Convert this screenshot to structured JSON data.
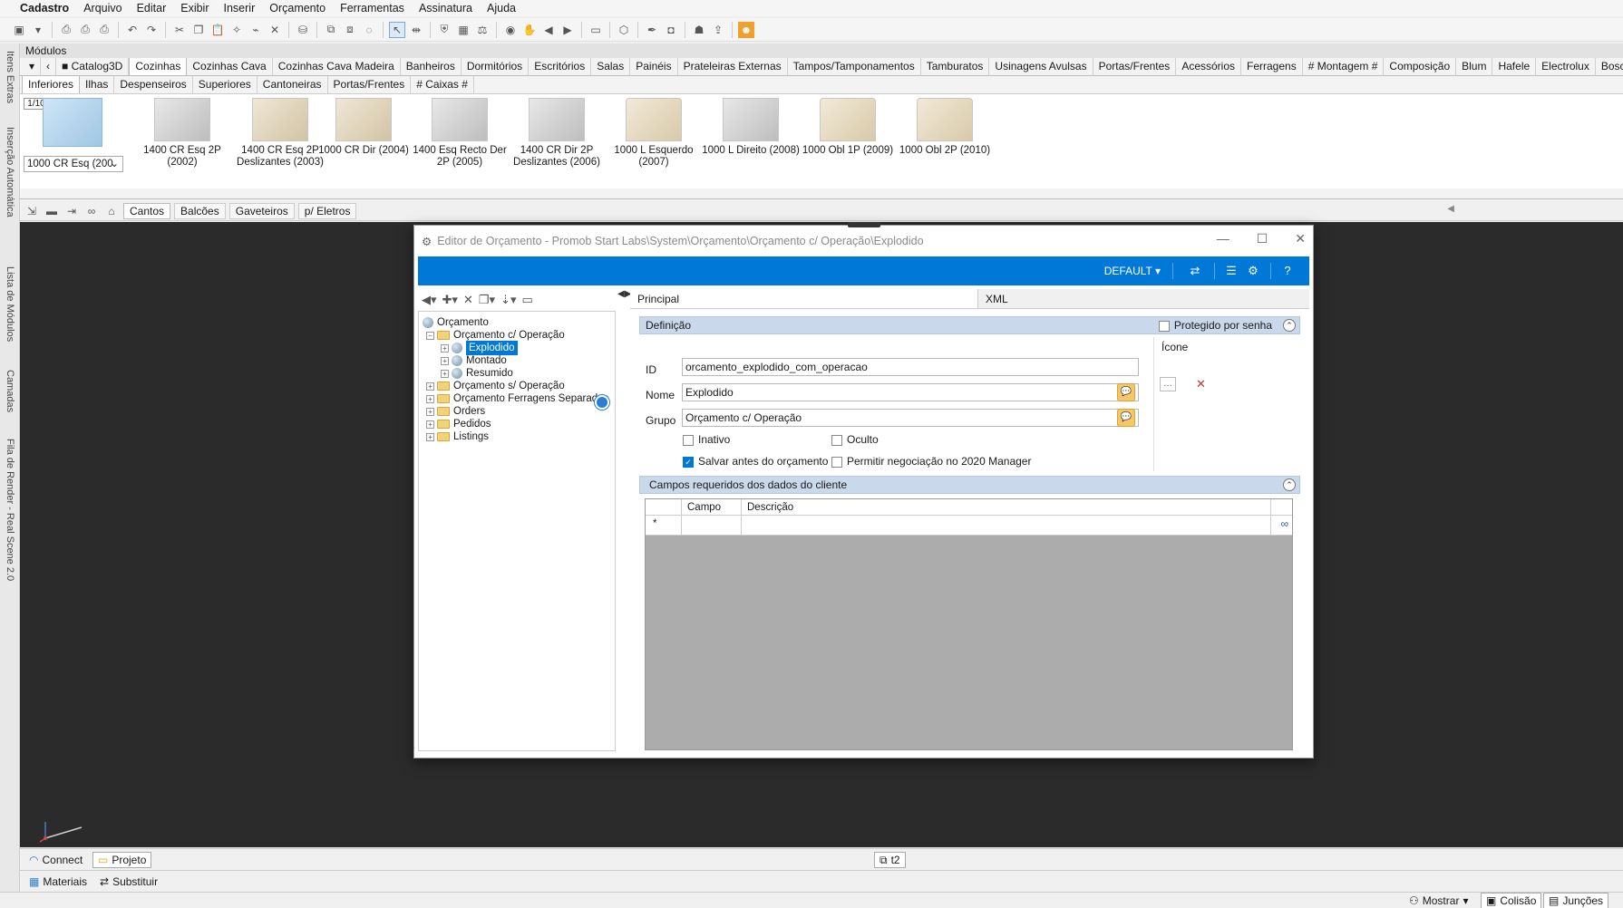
{
  "menubar": [
    "Cadastro",
    "Arquivo",
    "Editar",
    "Exibir",
    "Inserir",
    "Orçamento",
    "Ferramentas",
    "Assinatura",
    "Ajuda"
  ],
  "left_strip_tabs": [
    "Itens Extras",
    "Inserção Automática",
    "Lista de Módulos",
    "Camadas",
    "Fila de Render - Real Scene 2.0"
  ],
  "modules": {
    "title": "Módulos",
    "library_tabs": [
      "Catalog3D",
      "Cozinhas",
      "Cozinhas Cava",
      "Cozinhas Cava Madeira",
      "Banheiros",
      "Dormitórios",
      "Escritórios",
      "Salas",
      "Painéis",
      "Prateleiras Externas",
      "Tampos/Tamponamentos",
      "Tamburatos",
      "Usinagens Avulsas",
      "Portas/Frentes",
      "Acessórios",
      "Ferragens",
      "# Montagem #",
      "Composição",
      "Blum",
      "Hafele",
      "Electrolux",
      "Bosch"
    ],
    "active_library": "Cozinhas",
    "sub_tabs": [
      "Inferiores",
      "Ilhas",
      "Despenseiros",
      "Superiores",
      "Cantoneiras",
      "Portas/Frentes",
      "# Caixas #"
    ],
    "active_sub": "Inferiores",
    "pager": "1/10",
    "selected_module": "1000 CR Esq (200",
    "items": [
      {
        "label": "1400 CR Esq 2P (2002)",
        "style": "gray"
      },
      {
        "label": "1400 CR Esq 2P Deslizantes (2003)",
        "style": "wood"
      },
      {
        "label": "1000 CR Dir (2004)",
        "style": "wood"
      },
      {
        "label": "1400 Esq Recto Der 2P (2005)",
        "style": "gray"
      },
      {
        "label": "1400 CR Dir 2P Deslizantes (2006)",
        "style": "gray"
      },
      {
        "label": "1000 L Esquerdo (2007)",
        "style": "corner"
      },
      {
        "label": "1000 L Direito (2008)",
        "style": "gray"
      },
      {
        "label": "1000 Obl 1P (2009)",
        "style": "corner"
      },
      {
        "label": "1000 Obl 2P (2010)",
        "style": "corner"
      }
    ]
  },
  "toolbar2_tabs": [
    "Cantos",
    "Balcões",
    "Gaveteiros",
    "p/ Eletros"
  ],
  "toolbar2_active": "Cantos",
  "bottom": {
    "connect": "Connect",
    "projeto": "Projeto",
    "t2": "t2",
    "materiais": "Materiais",
    "substituir": "Substituir"
  },
  "statusbar": {
    "mostrar": "Mostrar",
    "colisao": "Colisão",
    "juncoes": "Junções"
  },
  "dialog": {
    "title": "Editor de Orçamento - Promob Start Labs\\System\\Orçamento\\Orçamento c/ Operação\\Explodido",
    "profile": "DEFAULT",
    "tabs": [
      "Principal",
      "XML"
    ],
    "tree": {
      "root": "Orçamento",
      "group1": "Orçamento c/ Operação",
      "children": [
        "Explodido",
        "Montado",
        "Resumido"
      ],
      "others": [
        "Orçamento s/ Operação",
        "Orçamento Ferragens Separadas",
        "Orders",
        "Pedidos",
        "Listings"
      ]
    },
    "definicao": {
      "header": "Definição",
      "protected_label": "Protegido por senha",
      "icon_label": "Ícone",
      "id_label": "ID",
      "id_value": "orcamento_explodido_com_operacao",
      "nome_label": "Nome",
      "nome_value": "Explodido",
      "grupo_label": "Grupo",
      "grupo_value": "Orçamento c/ Operação",
      "inativo": "Inativo",
      "oculto": "Oculto",
      "salvar": "Salvar antes do orçamento",
      "permitir": "Permitir negociação no 2020 Manager"
    },
    "campos": {
      "header": "Campos requeridos dos dados do cliente",
      "col_campo": "Campo",
      "col_descricao": "Descrição",
      "new_row_marker": "*"
    }
  }
}
